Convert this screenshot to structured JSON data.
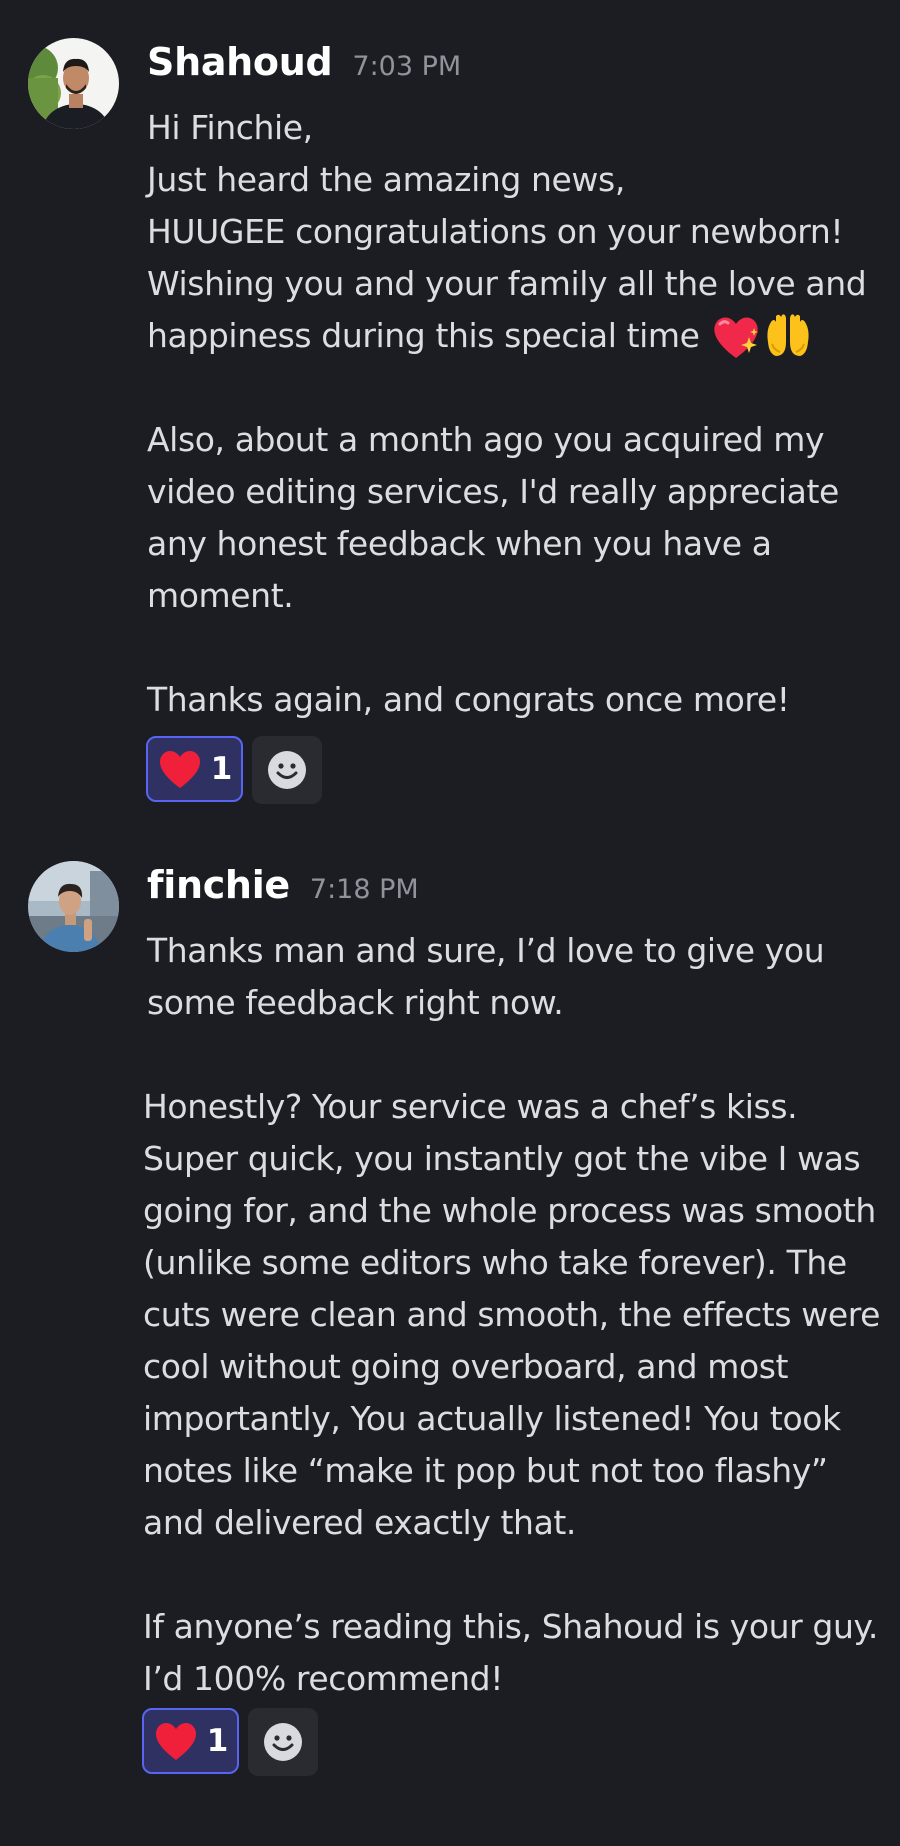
{
  "messages": [
    {
      "username": "Shahoud",
      "timestamp": "7:03 PM",
      "avatar": "avatar-shahoud",
      "lines": [
        "Hi Finchie,",
        "Just heard the amazing news,",
        "HUUGEE congratulations on your newborn!",
        "Wishing you and your family all the love and",
        "happiness during this special time",
        "",
        "Also, about a month ago you acquired my",
        "video editing services, I'd really appreciate",
        "any honest feedback when you have a",
        "moment.",
        "",
        "Thanks again, and congrats once more!"
      ],
      "inline_emojis": [
        "sparkling-heart",
        "raising-hands"
      ],
      "reaction": {
        "emoji": "red-heart",
        "count": "1"
      },
      "add_reaction_icon": "smiley-face-icon"
    },
    {
      "username": "finchie",
      "timestamp": "7:18 PM",
      "avatar": "avatar-finchie",
      "lines": [
        "Thanks man and sure, I’d love to give you",
        "some feedback right now.",
        "",
        "Honestly? Your service was a chef’s kiss.",
        "Super quick, you instantly got the vibe I was",
        "going for, and the whole process was smooth",
        "(unlike some editors who take forever). The",
        "cuts were clean and smooth, the effects were",
        "cool without going overboard, and most",
        "importantly, You actually listened! You took",
        "notes like “make it pop but not too flashy”",
        "and delivered exactly that.",
        "",
        "If anyone’s reading this, Shahoud is your guy.",
        "I’d 100% recommend!"
      ],
      "reaction": {
        "emoji": "red-heart",
        "count": "1"
      },
      "add_reaction_icon": "smiley-face-icon"
    }
  ],
  "colors": {
    "background": "#1c1d22",
    "text": "#dbdee1",
    "username": "#ffffff",
    "timestamp": "#90939b",
    "reaction_border": "#5865f2",
    "reaction_bg": "#2f3163",
    "add_reaction_bg": "#2a2b31",
    "heart": "#f01f3a"
  }
}
